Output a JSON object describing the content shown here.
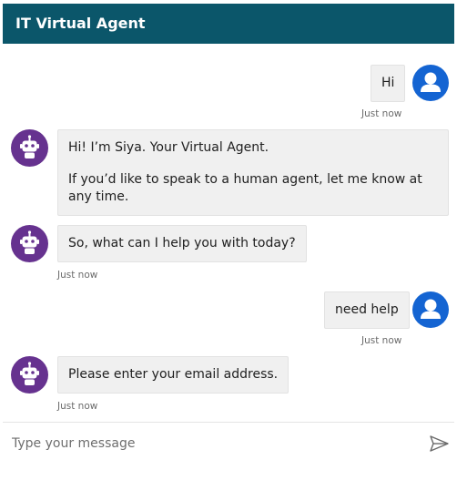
{
  "header": {
    "title": "IT Virtual Agent"
  },
  "messages": [
    {
      "sender": "user",
      "text": "Hi",
      "time": "Just now"
    },
    {
      "sender": "agent",
      "paragraphs": [
        "Hi! I’m Siya. Your Virtual Agent.",
        "If you’d like to speak to a human agent, let me know at any time."
      ]
    },
    {
      "sender": "agent",
      "text": "So, what can I help you with today?",
      "time": "Just now"
    },
    {
      "sender": "user",
      "text": "need help",
      "time": "Just now"
    },
    {
      "sender": "agent",
      "text": "Please enter your email address.",
      "time": "Just now"
    }
  ],
  "composer": {
    "placeholder": "Type your message",
    "value": ""
  },
  "icons": {
    "user_avatar": "user-icon",
    "agent_avatar": "robot-icon",
    "send": "send-icon"
  },
  "colors": {
    "header_bg": "#0b566a",
    "user_avatar": "#1464d2",
    "agent_avatar": "#66328f",
    "bubble_bg": "#f0f0f0"
  }
}
